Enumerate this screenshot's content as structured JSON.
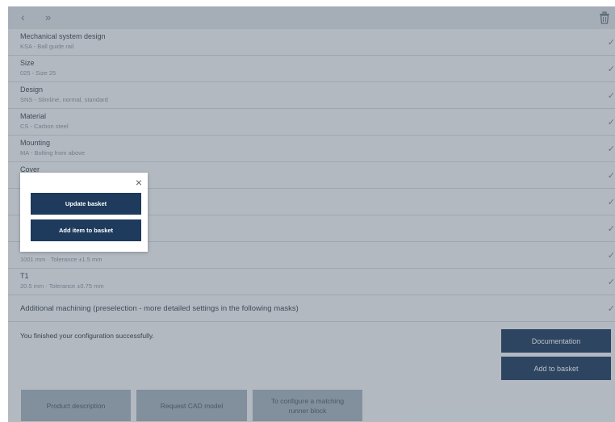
{
  "toolbar": {
    "back": "‹",
    "forward": "»",
    "trash_icon": "trash-icon"
  },
  "rows": [
    {
      "title": "Mechanical system design",
      "sub": "KSA - Ball guide rail"
    },
    {
      "title": "Size",
      "sub": "025 - Size 25"
    },
    {
      "title": "Design",
      "sub": "SNS - Slimline, normal, standard"
    },
    {
      "title": "Material",
      "sub": "CS - Carbon steel"
    },
    {
      "title": "Mounting",
      "sub": "MA - Bolting from above"
    },
    {
      "title": "Cover",
      "sub": ""
    },
    {
      "title": "",
      "sub": ""
    },
    {
      "title": "",
      "sub": ""
    },
    {
      "title": "",
      "sub": "1001 mm · Tolerance ±1.5 mm"
    },
    {
      "title": "T1",
      "sub": "20.5 mm · Tolerance ±0.75 mm"
    },
    {
      "title": "Additional machining (preselection - more detailed settings in the following masks)",
      "sub": ""
    }
  ],
  "check": "✓",
  "status": "You finished your configuration successfully.",
  "buttons": {
    "documentation": "Documentation",
    "add_to_basket": "Add to basket",
    "product_description": "Product description",
    "request_cad": "Request CAD model",
    "runner_block_line1": "To configure a matching",
    "runner_block_line2": "runner block"
  },
  "modal": {
    "close": "×",
    "update_basket": "Update basket",
    "add_item": "Add item to basket"
  },
  "colors": {
    "primary": "#1e3a5c",
    "overlay": "#46586980",
    "grey_button": "#a7b2bd"
  }
}
